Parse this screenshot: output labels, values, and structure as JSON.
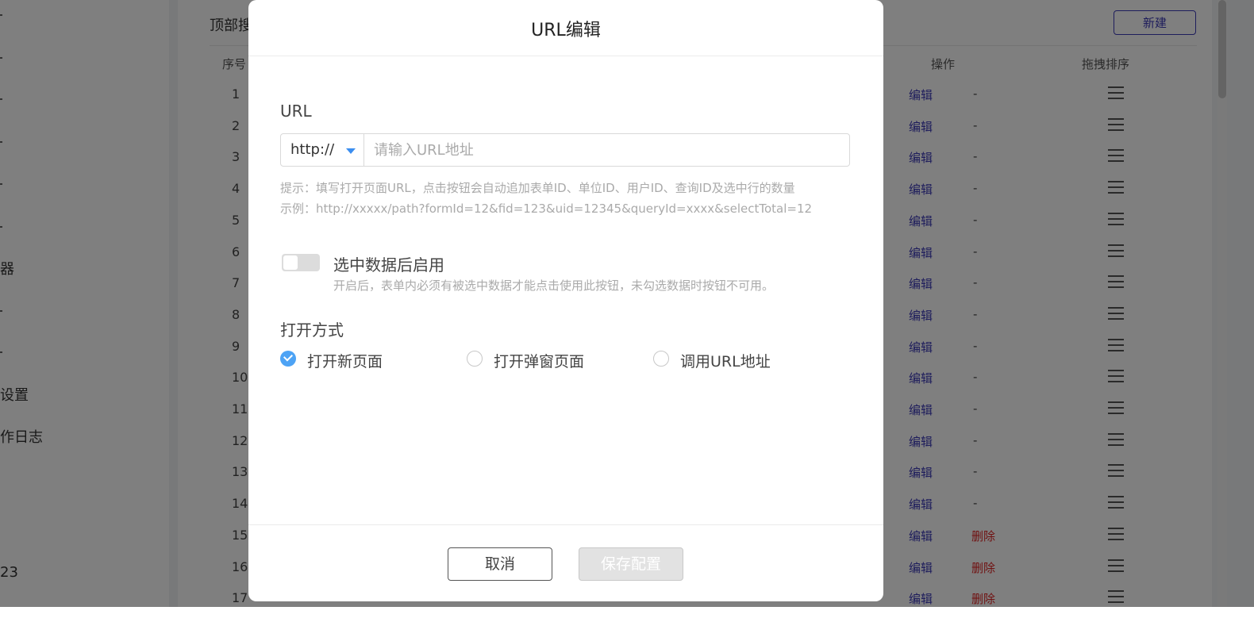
{
  "sidebar": {
    "items": [
      {
        "label": "器"
      },
      {
        "label": "设置"
      },
      {
        "label": "作日志"
      },
      {
        "label": "23"
      }
    ]
  },
  "background": {
    "panel_title": "顶部搜",
    "new_button": "新建",
    "columns": {
      "index": "序号",
      "action": "操作",
      "sort": "拖拽排序"
    },
    "rows": [
      {
        "num": "1",
        "edit": "编辑",
        "op": "-"
      },
      {
        "num": "2",
        "edit": "编辑",
        "op": "-"
      },
      {
        "num": "3",
        "edit": "编辑",
        "op": "-"
      },
      {
        "num": "4",
        "edit": "编辑",
        "op": "-"
      },
      {
        "num": "5",
        "edit": "编辑",
        "op": "-"
      },
      {
        "num": "6",
        "edit": "编辑",
        "op": "-"
      },
      {
        "num": "7",
        "edit": "编辑",
        "op": "-"
      },
      {
        "num": "8",
        "edit": "编辑",
        "op": "-"
      },
      {
        "num": "9",
        "edit": "编辑",
        "op": "-"
      },
      {
        "num": "10",
        "edit": "编辑",
        "op": "-"
      },
      {
        "num": "11",
        "edit": "编辑",
        "op": "-"
      },
      {
        "num": "12",
        "edit": "编辑",
        "op": "-"
      },
      {
        "num": "13",
        "edit": "编辑",
        "op": "-"
      },
      {
        "num": "14",
        "edit": "编辑",
        "op": "-"
      },
      {
        "num": "15",
        "edit": "编辑",
        "op": "删除"
      },
      {
        "num": "16",
        "edit": "编辑",
        "op": "删除"
      },
      {
        "num": "17",
        "edit": "编辑",
        "op": "删除"
      }
    ]
  },
  "modal": {
    "title": "URL编辑",
    "url_label": "URL",
    "protocol": "http://",
    "url_placeholder": "请输入URL地址",
    "hint_line1": "提示：填写打开页面URL，点击按钮会自动追加表单ID、单位ID、用户ID、查询ID及选中行的数量",
    "hint_line2": "示例：http://xxxxx/path?formId=12&fid=123&uid=12345&queryId=xxxx&selectTotal=12",
    "switch_label": "选中数据后启用",
    "switch_on": false,
    "switch_desc": "开启后，表单内必须有被选中数据才能点击使用此按钮，未勾选数据时按钮不可用。",
    "open_label": "打开方式",
    "open_options": [
      {
        "label": "打开新页面",
        "checked": true
      },
      {
        "label": "打开弹窗页面",
        "checked": false
      },
      {
        "label": "调用URL地址",
        "checked": false
      }
    ],
    "cancel": "取消",
    "save": "保存配置"
  },
  "colors": {
    "accent": "#4da3f5",
    "link": "#3d3ab8",
    "danger": "#e02424"
  }
}
